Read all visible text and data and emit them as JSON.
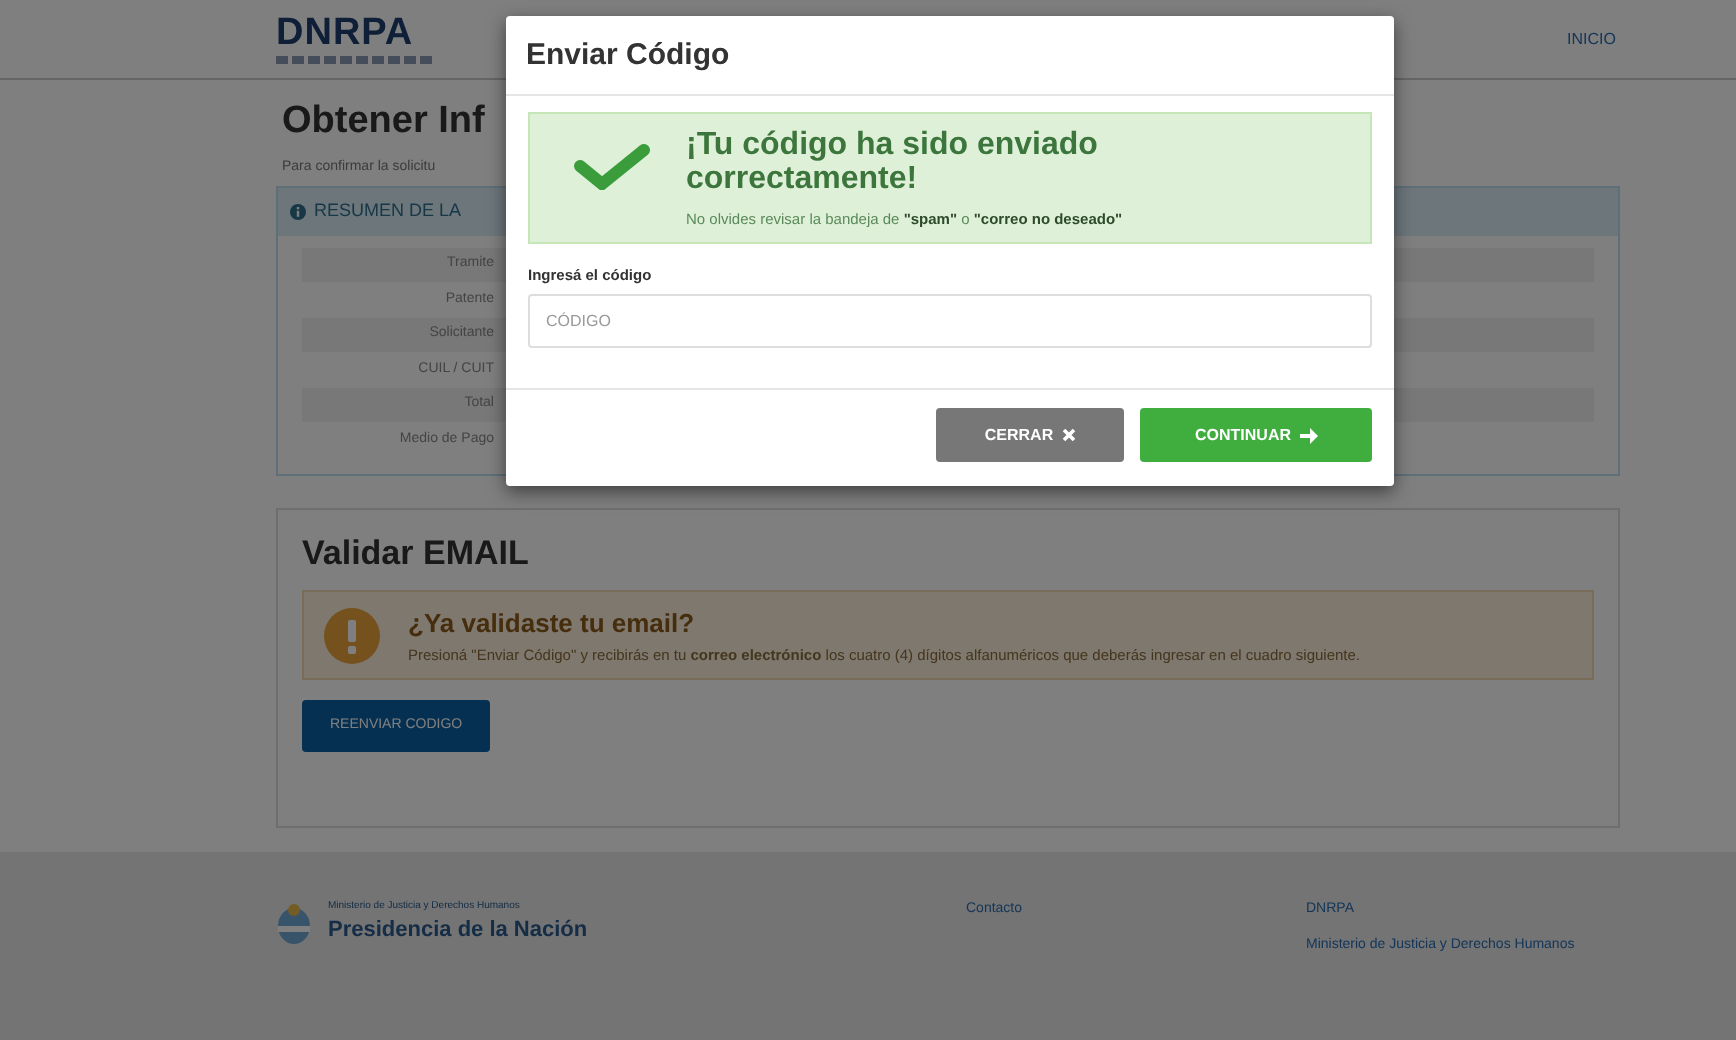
{
  "header": {
    "logo": "DNRPA",
    "nav": [
      {
        "label": "INICIO"
      }
    ]
  },
  "page": {
    "title": "Obtener Inf",
    "intro": "Para confirmar la solicitu",
    "summary": {
      "heading": "RESUMEN DE LA",
      "rows": [
        {
          "label": "Tramite"
        },
        {
          "label": "Patente"
        },
        {
          "label": "Solicitante"
        },
        {
          "label": "CUIL / CUIT"
        },
        {
          "label": "Total"
        },
        {
          "label": "Medio de Pago"
        }
      ]
    }
  },
  "validate": {
    "title": "Validar EMAIL",
    "alert": {
      "title": "¿Ya validaste tu email?",
      "text": "Presioná \"Enviar Código\" y recibirás en tu **correo electrónico** los cuatro (4) dígitos alfanuméricos que deberás ingresar en el cuadro siguiente."
    },
    "button": "REENVIAR CODIGO"
  },
  "footer": {
    "brand_small": "Ministerio de Justicia y Derechos Humanos",
    "brand": "Presidencia de la Nación",
    "links": [
      "Contacto"
    ],
    "org": "DNRPA",
    "org_detail": "Ministerio de Justicia y Derechos Humanos"
  },
  "modal": {
    "title": "Enviar Código",
    "alert": {
      "title": "¡Tu código ha sido enviado correctamente!",
      "text": "No olvides revisar la bandeja de **\"spam\"** o **\"correo no deseado\"**"
    },
    "field": {
      "label": "Ingresá el código",
      "placeholder": "CÓDIGO"
    },
    "buttons": [
      {
        "label": "CERRAR",
        "kind": "close"
      },
      {
        "label": "CONTINUAR",
        "kind": "continue"
      }
    ]
  }
}
